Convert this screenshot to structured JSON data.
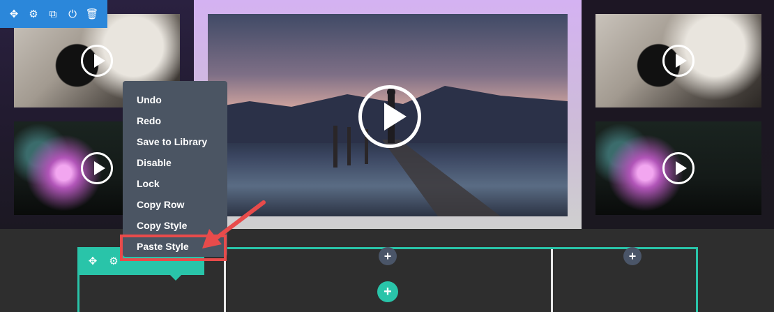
{
  "section_toolbar": {
    "icons": [
      "move-icon",
      "gear-icon",
      "duplicate-icon",
      "power-icon",
      "trash-icon"
    ],
    "glyphs": [
      "✥",
      "⚙",
      "⧉",
      "⏻",
      "🗑"
    ]
  },
  "row_toolbar": {
    "icons": [
      "move-icon",
      "gear-icon"
    ],
    "glyphs": [
      "✥",
      "⚙"
    ]
  },
  "context_menu": {
    "items": [
      {
        "label": "Undo"
      },
      {
        "label": "Redo"
      },
      {
        "label": "Save to Library"
      },
      {
        "label": "Disable"
      },
      {
        "label": "Lock"
      },
      {
        "label": "Copy Row"
      },
      {
        "label": "Copy Style"
      },
      {
        "label": "Paste Style"
      }
    ]
  },
  "add_buttons": {
    "symbol": "+"
  },
  "colors": {
    "section_accent": "#2b87da",
    "row_accent": "#29c4a9",
    "menu_bg": "#4b5563",
    "highlight": "#e84b4b"
  }
}
